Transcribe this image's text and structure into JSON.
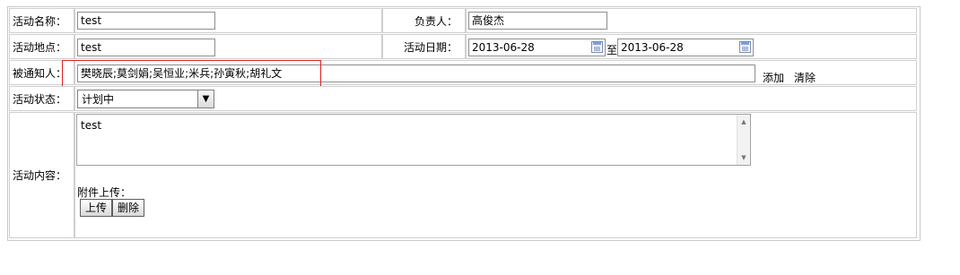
{
  "form": {
    "name": {
      "label": "活动名称：",
      "value": "test"
    },
    "owner": {
      "label": "负责人：",
      "value": "高俊杰"
    },
    "place": {
      "label": "活动地点：",
      "value": "test"
    },
    "date": {
      "label": "活动日期：",
      "start": "2013-06-28",
      "separator": "至",
      "end": "2013-06-28"
    },
    "notify": {
      "label": "被通知人：",
      "value": "樊晓辰;莫剑娟;吴恒业;米兵;孙寅秋;胡礼文",
      "add_label": "添加",
      "clear_label": "清除"
    },
    "status": {
      "label": "活动状态：",
      "selected": "计划中"
    },
    "content": {
      "label": "活动内容：",
      "value": "test"
    },
    "attachment": {
      "label": "附件上传：",
      "upload_label": "上传",
      "delete_label": "删除"
    }
  },
  "colors": {
    "highlight_box": "#e02020",
    "cell_border": "#cfcfcf"
  },
  "icons": {
    "date_picker": "calendar-icon",
    "dropdown": "chevron-down-icon"
  }
}
